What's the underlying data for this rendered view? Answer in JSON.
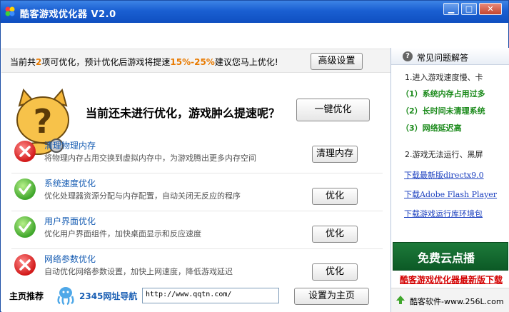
{
  "window": {
    "title": "酷客游戏优化器 V2.0",
    "minimize_glyph": "▁",
    "maximize_glyph": "□",
    "close_glyph": "✕"
  },
  "topbar": {
    "text_before": "当前共",
    "count": "2",
    "text_mid": "项可优化，预计优化后游戏将提速",
    "percent": "15%-25%",
    "text_after": "建议您马上优化!",
    "advanced_button": "高级设置"
  },
  "hero": {
    "message": "当前还未进行优化，游戏肿么提速呢？",
    "one_click_button": "一键优化"
  },
  "items": [
    {
      "title": "清理物理内存",
      "desc": "将物理内存占用交换到虚拟内存中，为游戏腾出更多内存空间",
      "status": "red",
      "button": "清理内存"
    },
    {
      "title": "系统速度优化",
      "desc": "优化处理器资源分配与内存配置，自动关闭无反应的程序",
      "status": "green",
      "button": "优化"
    },
    {
      "title": "用户界面优化",
      "desc": "优化用户界面组件，加快桌面显示和反应速度",
      "status": "green",
      "button": "优化"
    },
    {
      "title": "网络参数优化",
      "desc": "自动优化网络参数设置，加快上网速度，降低游戏延迟",
      "status": "red",
      "button": "优化"
    }
  ],
  "bottom": {
    "home_label": "主页推荐",
    "nav_link": "2345网址导航",
    "url_value": "http://www.qqtn.com/",
    "set_home_button": "设置为主页"
  },
  "sidebar": {
    "faq_title": "常见问题解答",
    "q1": "1.进入游戏速度慢、卡",
    "a1": "（1）系统内存占用过多",
    "a2": "（2）长时间未清理系统",
    "a3": "（3）网络延迟高",
    "q2": "2.游戏无法运行、黑屏",
    "link1": "下载最新版directx9.0",
    "link2": "下载Adobe Flash Player",
    "link3": "下载游戏运行库环境包",
    "banner_text": "免费云点播",
    "download_link": "酷客游戏优化器最新版下载",
    "footer_text": "酷客软件-www.256L.com"
  },
  "colors": {
    "title_bar": "#1a5fd2",
    "accent_orange": "#e87a00",
    "link_blue": "#1a5fb4",
    "answer_green": "#1a8a1a",
    "download_red": "#d40000",
    "status_red": "#d21919",
    "status_green": "#3fa62b"
  }
}
